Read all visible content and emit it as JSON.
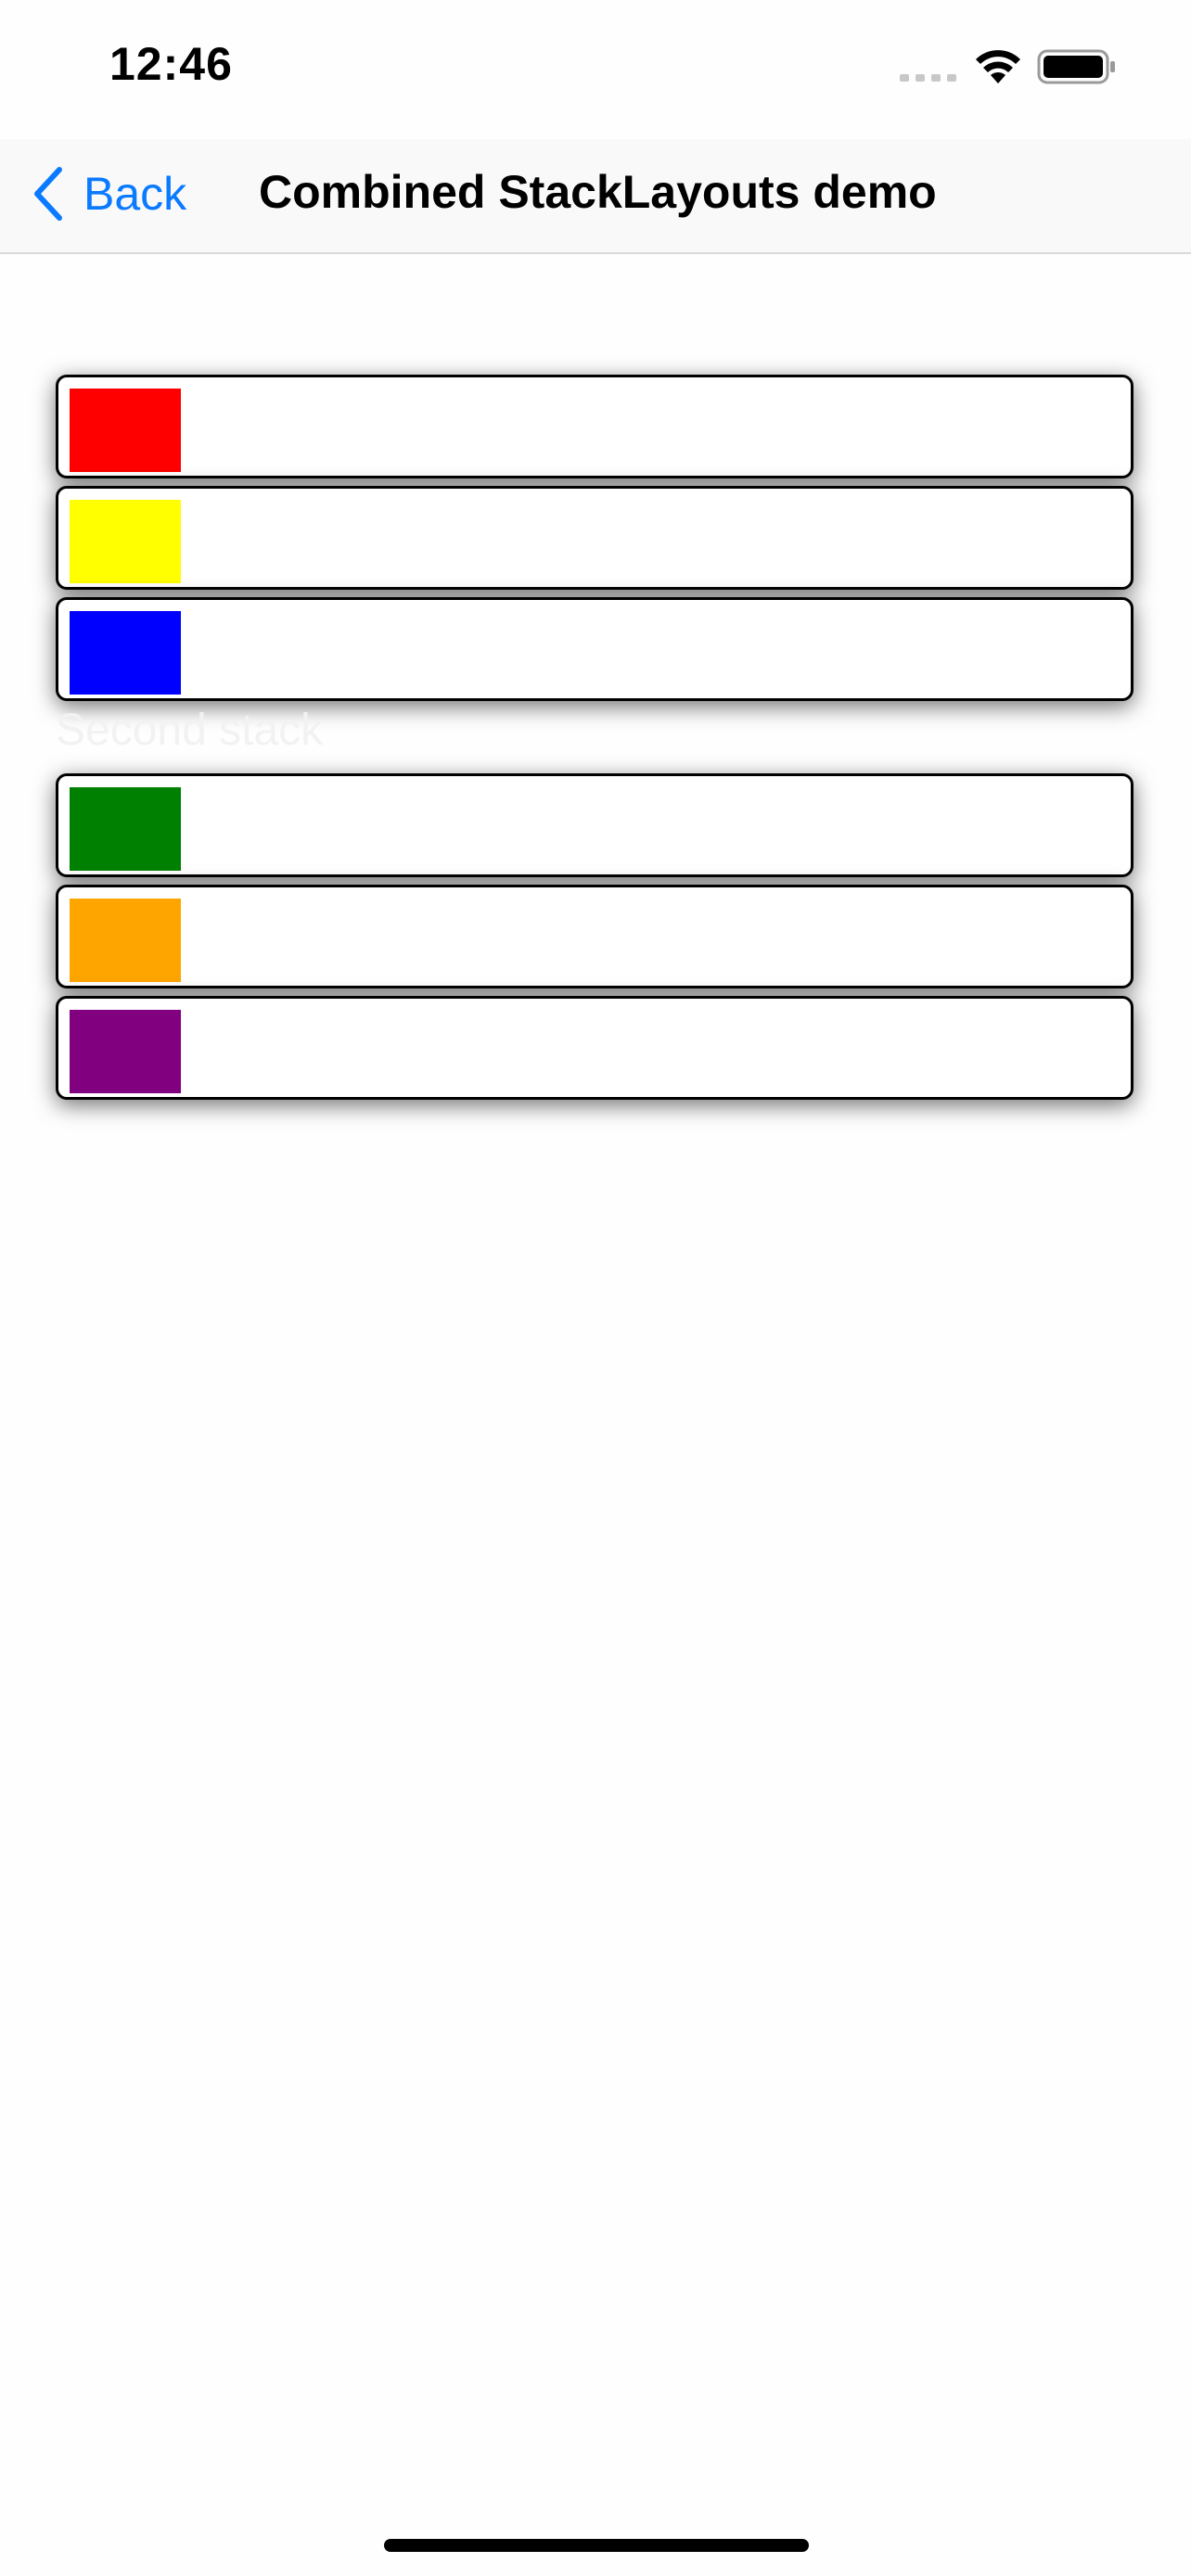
{
  "status_bar": {
    "time": "12:46",
    "signal_icon": "signal-bars-icon",
    "wifi_icon": "wifi-icon",
    "battery_icon": "battery-icon"
  },
  "nav": {
    "back_label": "Back",
    "back_icon": "chevron-left-icon",
    "title": "Combined StackLayouts demo"
  },
  "colors": {
    "accent": "#0a7aff"
  },
  "group1": {
    "rows": [
      {
        "color": "#ff0000"
      },
      {
        "color": "#ffff00"
      },
      {
        "color": "#0000ff"
      }
    ]
  },
  "group2": {
    "label": "Second stack",
    "rows": [
      {
        "color": "#008000"
      },
      {
        "color": "#ffa500"
      },
      {
        "color": "#800080"
      }
    ]
  }
}
